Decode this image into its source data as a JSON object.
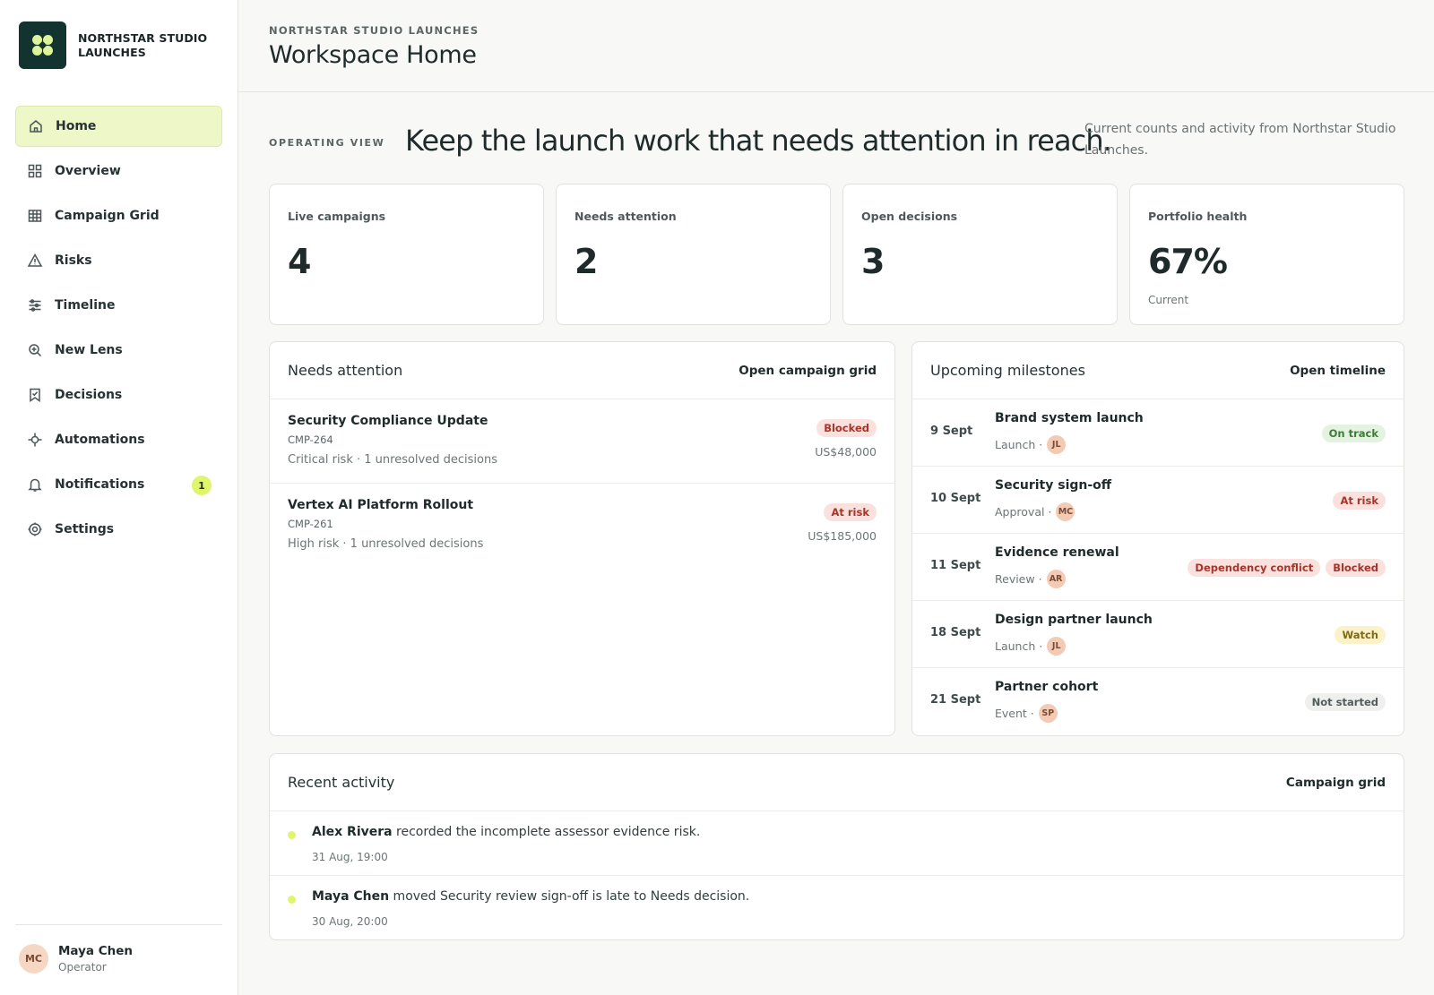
{
  "brand": {
    "name": "NORTHSTAR STUDIO LAUNCHES"
  },
  "nav": {
    "items": [
      {
        "label": "Home"
      },
      {
        "label": "Overview"
      },
      {
        "label": "Campaign Grid"
      },
      {
        "label": "Risks"
      },
      {
        "label": "Timeline"
      },
      {
        "label": "New Lens"
      },
      {
        "label": "Decisions"
      },
      {
        "label": "Automations"
      },
      {
        "label": "Notifications",
        "badge": "1"
      },
      {
        "label": "Settings"
      }
    ]
  },
  "user": {
    "initials": "MC",
    "name": "Maya Chen",
    "role": "Operator"
  },
  "header": {
    "eyebrow": "NORTHSTAR STUDIO LAUNCHES",
    "title": "Workspace Home"
  },
  "operating": {
    "label": "OPERATING VIEW",
    "headline": "Keep the launch work that needs attention in reach.",
    "description": "Current counts and activity from Northstar Studio Launches."
  },
  "metrics": [
    {
      "label": "Live campaigns",
      "value": "4"
    },
    {
      "label": "Needs attention",
      "value": "2"
    },
    {
      "label": "Open decisions",
      "value": "3"
    },
    {
      "label": "Portfolio health",
      "value": "67%",
      "sub": "Current"
    }
  ],
  "attention": {
    "title": "Needs attention",
    "link": "Open campaign grid",
    "items": [
      {
        "name": "Security Compliance Update",
        "code": "CMP-264",
        "meta": "Critical risk · 1 unresolved decisions",
        "status": "Blocked",
        "amount": "US$48,000"
      },
      {
        "name": "Vertex AI Platform Rollout",
        "code": "CMP-261",
        "meta": "High risk · 1 unresolved decisions",
        "status": "At risk",
        "amount": "US$185,000"
      }
    ]
  },
  "milestones": {
    "title": "Upcoming milestones",
    "link": "Open timeline",
    "items": [
      {
        "date": "9 Sept",
        "name": "Brand system launch",
        "type": "Launch ·",
        "owner": "JL",
        "badges": [
          "On track"
        ]
      },
      {
        "date": "10 Sept",
        "name": "Security sign-off",
        "type": "Approval ·",
        "owner": "MC",
        "badges": [
          "At risk"
        ]
      },
      {
        "date": "11 Sept",
        "name": "Evidence renewal",
        "type": "Review ·",
        "owner": "AR",
        "badges": [
          "Dependency conflict",
          "Blocked"
        ]
      },
      {
        "date": "18 Sept",
        "name": "Design partner launch",
        "type": "Launch ·",
        "owner": "JL",
        "badges": [
          "Watch"
        ]
      },
      {
        "date": "21 Sept",
        "name": "Partner cohort",
        "type": "Event ·",
        "owner": "SP",
        "badges": [
          "Not started"
        ]
      }
    ]
  },
  "activity": {
    "title": "Recent activity",
    "link": "Campaign grid",
    "items": [
      {
        "actor": "Alex Rivera",
        "text": " recorded the incomplete assessor evidence risk.",
        "time": "31 Aug, 19:00"
      },
      {
        "actor": "Maya Chen",
        "text": " moved Security review sign-off is late to Needs decision.",
        "time": "30 Aug, 20:00"
      }
    ]
  },
  "colors": {
    "accent": "#dff56b",
    "brand": "#133330",
    "danger_bg": "#fbe1dd",
    "success_bg": "#e3f3df",
    "warning_bg": "#fbf2c9",
    "neutral_bg": "#efefed"
  }
}
